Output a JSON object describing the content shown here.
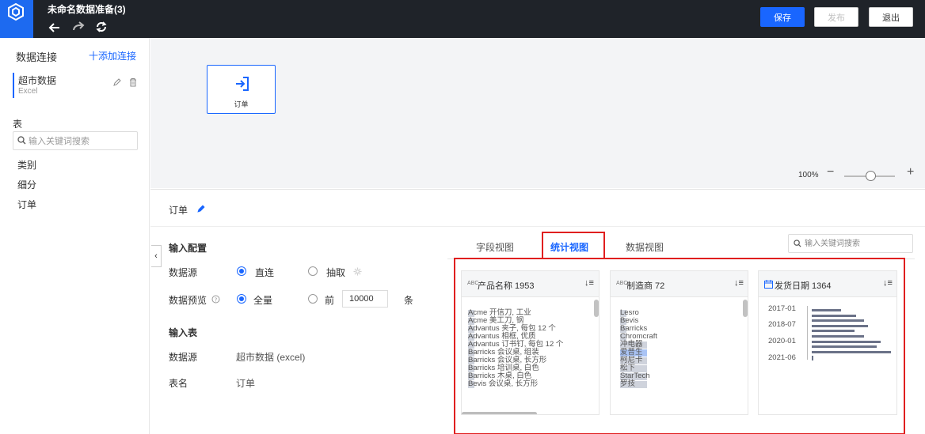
{
  "header": {
    "title": "未命名数据准备(3)",
    "save_label": "保存",
    "publish_label": "发布",
    "exit_label": "退出"
  },
  "left_panel": {
    "title": "数据连接",
    "add_label": "十添加连接",
    "connection": {
      "name": "超市数据",
      "type": "Excel"
    },
    "tables_title": "表",
    "search_placeholder": "输入关键词搜索",
    "tables": [
      "类别",
      "细分",
      "订单"
    ]
  },
  "canvas": {
    "node_label": "订单",
    "zoom": "100%"
  },
  "bottom": {
    "title": "订单",
    "input_config_title": "输入配置",
    "datasource_label": "数据源",
    "mode_direct": "直连",
    "mode_extract": "抽取",
    "preview_label": "数据预览",
    "preview_all": "全量",
    "preview_first": "前",
    "preview_count": "10000",
    "preview_unit": "条",
    "input_table_title": "输入表",
    "datasource_value_label": "数据源",
    "datasource_value": "超市数据 (excel)",
    "tablename_label": "表名",
    "tablename_value": "订单"
  },
  "tabs": {
    "field_view": "字段视图",
    "stats_view": "统计视图",
    "data_view": "数据视图",
    "active": "stats_view",
    "search_placeholder": "输入关键词搜索"
  },
  "stats_cards": [
    {
      "type_badge": "ABC",
      "header": "产品名称 1953",
      "items": [
        "Acme 开信刀, 工业",
        "Acme 美工刀, 钢",
        "Advantus 夹子, 每包 12 个",
        "Advantus 相框, 优质",
        "Advantus 订书钉, 每包 12 个",
        "Barricks 会议桌, 组装",
        "Barricks 会议桌, 长方形",
        "Barricks 培训桌, 白色",
        "Barricks 木桌, 白色",
        "Bevis 会议桌, 长方形"
      ]
    },
    {
      "type_badge": "ABC",
      "header": "制造商 72",
      "items": [
        "Lesro",
        "Bevis",
        "Barricks",
        "Chromcraft",
        "冲电器",
        "爱普生",
        "柯尼卡",
        "松下",
        "StarTech",
        "罗技"
      ],
      "highlighted": "爱普生"
    },
    {
      "type_badge": "date",
      "header": "发货日期 1364",
      "axis_labels": [
        "2017-01",
        "2018-07",
        "2020-01",
        "2021-06"
      ],
      "histogram": [
        0.37,
        0.56,
        0.66,
        0.71,
        0.54,
        0.66,
        0.87,
        0.82,
        1.0,
        0.02
      ]
    }
  ],
  "colors": {
    "accent": "#1966ff",
    "topbar": "#1f2329",
    "highlight_border": "#e01f1f"
  }
}
